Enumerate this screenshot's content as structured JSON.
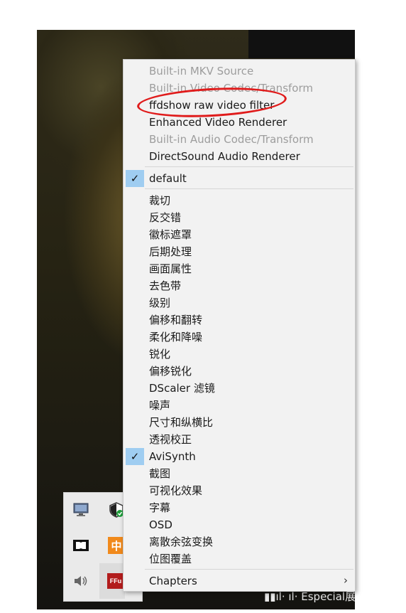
{
  "menu": {
    "items": [
      {
        "label": "Built-in MKV Source",
        "disabled": true
      },
      {
        "label": "Built-in Video Codec/Transform",
        "disabled": true
      },
      {
        "label": "ffdshow raw video filter",
        "disabled": false
      },
      {
        "label": "Enhanced Video Renderer",
        "disabled": false
      },
      {
        "label": "Built-in Audio Codec/Transform",
        "disabled": true
      },
      {
        "label": "DirectSound Audio Renderer",
        "disabled": false
      },
      {
        "label": "default",
        "checked": true
      },
      {
        "label": "裁切"
      },
      {
        "label": "反交错"
      },
      {
        "label": "徽标遮罩"
      },
      {
        "label": "后期处理"
      },
      {
        "label": "画面属性"
      },
      {
        "label": "去色带"
      },
      {
        "label": "级别"
      },
      {
        "label": "偏移和翻转"
      },
      {
        "label": "柔化和降噪"
      },
      {
        "label": "锐化"
      },
      {
        "label": "偏移锐化"
      },
      {
        "label": "DScaler 滤镜"
      },
      {
        "label": "噪声"
      },
      {
        "label": "尺寸和纵横比"
      },
      {
        "label": "透视校正"
      },
      {
        "label": "AviSynth",
        "checked": true
      },
      {
        "label": "截图"
      },
      {
        "label": "可视化效果"
      },
      {
        "label": "字幕"
      },
      {
        "label": "OSD"
      },
      {
        "label": "离散余弦变换"
      },
      {
        "label": "位图覆盖"
      },
      {
        "label": "Chapters",
        "submenu": true
      }
    ],
    "check_glyph": "✓",
    "submenu_glyph": "›"
  },
  "tray": {
    "icons": [
      "monitor-icon",
      "shield-check-icon",
      "dolby-icon",
      "ime-chinese-icon",
      "speaker-icon",
      "ffdshow-icon"
    ],
    "ime_label": "中",
    "dolby_label": "◨",
    "ffdshow_label": "FFu"
  },
  "watermark": "Especial展",
  "colors": {
    "highlight_circle": "#e01b1b",
    "check_bg": "#9fcdf1",
    "menu_bg": "#f2f2f2",
    "disabled_text": "#9d9d9d"
  }
}
